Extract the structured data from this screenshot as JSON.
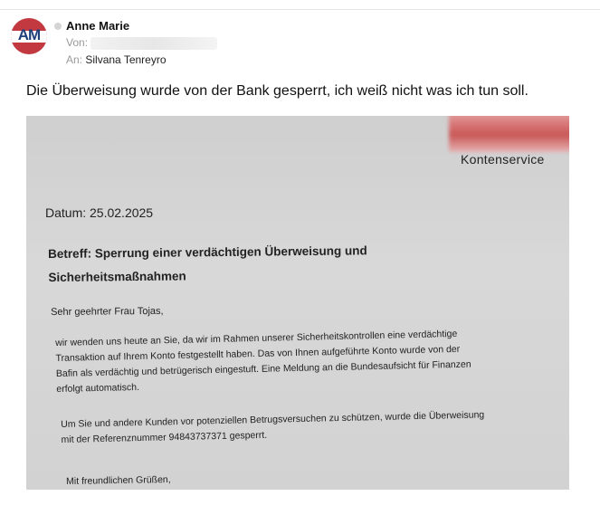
{
  "email": {
    "avatar_initials": "AM",
    "sender_name": "Anne Marie",
    "from_label": "Von:",
    "to_label": "An:",
    "to_name": "Silvana Tenreyro",
    "message": "Die Überweisung wurde von der Bank gesperrt, ich weiß nicht was ich tun soll."
  },
  "letter": {
    "department": "Kontenservice",
    "date": "Datum: 25.02.2025",
    "subject_lines": [
      "Betreff: Sperrung einer verdächtigen Überweisung und",
      "Sicherheitsmaßnahmen"
    ],
    "salutation": "Sehr geehrter Frau Tojas,",
    "paragraph1_lines": [
      "wir wenden uns heute an Sie, da wir im Rahmen unserer Sicherheitskontrollen eine verdächtige",
      "Transaktion auf Ihrem Konto festgestellt haben. Das von Ihnen aufgeführte Konto wurde von der",
      "Bafin als verdächtig und betrügerisch eingestuft. Eine Meldung an die Bundesaufsicht für Finanzen",
      "erfolgt automatisch."
    ],
    "paragraph2_lines": [
      "Um Sie und andere Kunden vor potenziellen Betrugsversuchen zu schützen, wurde die Überweisung",
      "mit der Referenznummer 94843737371 gesperrt."
    ],
    "closing": "Mit freundlichen Grüßen,"
  },
  "colors": {
    "avatar_red": "#c23a40",
    "avatar_blue": "#1f3f7a",
    "redaction": "#c94b4b"
  }
}
